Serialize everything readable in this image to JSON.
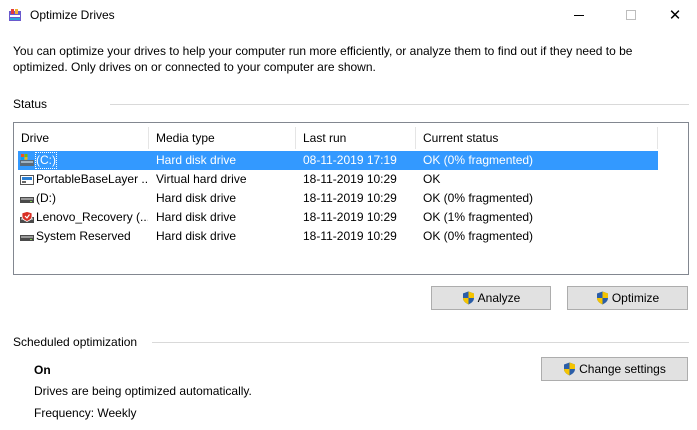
{
  "window": {
    "title": "Optimize Drives",
    "minimize_glyph": "—",
    "close_glyph": "✕"
  },
  "intro_text": "You can optimize your drives to help your computer run more efficiently, or analyze them to find out if they need to be optimized. Only drives on or connected to your computer are shown.",
  "status": {
    "label": "Status",
    "columns": [
      "Drive",
      "Media type",
      "Last run",
      "Current status"
    ],
    "drives": [
      {
        "icon": "os-drive-icon",
        "drive": "(C:)",
        "media_type": "Hard disk drive",
        "last_run": "08-11-2019 17:19",
        "current_status": "OK (0% fragmented)",
        "selected": true
      },
      {
        "icon": "virtual-drive-icon",
        "drive": "PortableBaseLayer ...",
        "media_type": "Virtual hard drive",
        "last_run": "18-11-2019 10:29",
        "current_status": "OK",
        "selected": false
      },
      {
        "icon": "hard-drive-icon",
        "drive": "(D:)",
        "media_type": "Hard disk drive",
        "last_run": "18-11-2019 10:29",
        "current_status": "OK (0% fragmented)",
        "selected": false
      },
      {
        "icon": "recovery-drive-icon",
        "drive": "Lenovo_Recovery (...",
        "media_type": "Hard disk drive",
        "last_run": "18-11-2019 10:29",
        "current_status": "OK (1% fragmented)",
        "selected": false
      },
      {
        "icon": "hard-drive-icon",
        "drive": "System Reserved",
        "media_type": "Hard disk drive",
        "last_run": "18-11-2019 10:29",
        "current_status": "OK (0% fragmented)",
        "selected": false
      }
    ]
  },
  "buttons": {
    "analyze": "Analyze",
    "optimize": "Optimize",
    "change_settings": "Change settings"
  },
  "scheduled": {
    "label": "Scheduled optimization",
    "state": "On",
    "description": "Drives are being optimized automatically.",
    "frequency": "Frequency: Weekly"
  },
  "colors": {
    "selection": "#3399ff",
    "button_face": "#e1e1e1",
    "button_border": "#adadad",
    "list_border": "#828790"
  }
}
